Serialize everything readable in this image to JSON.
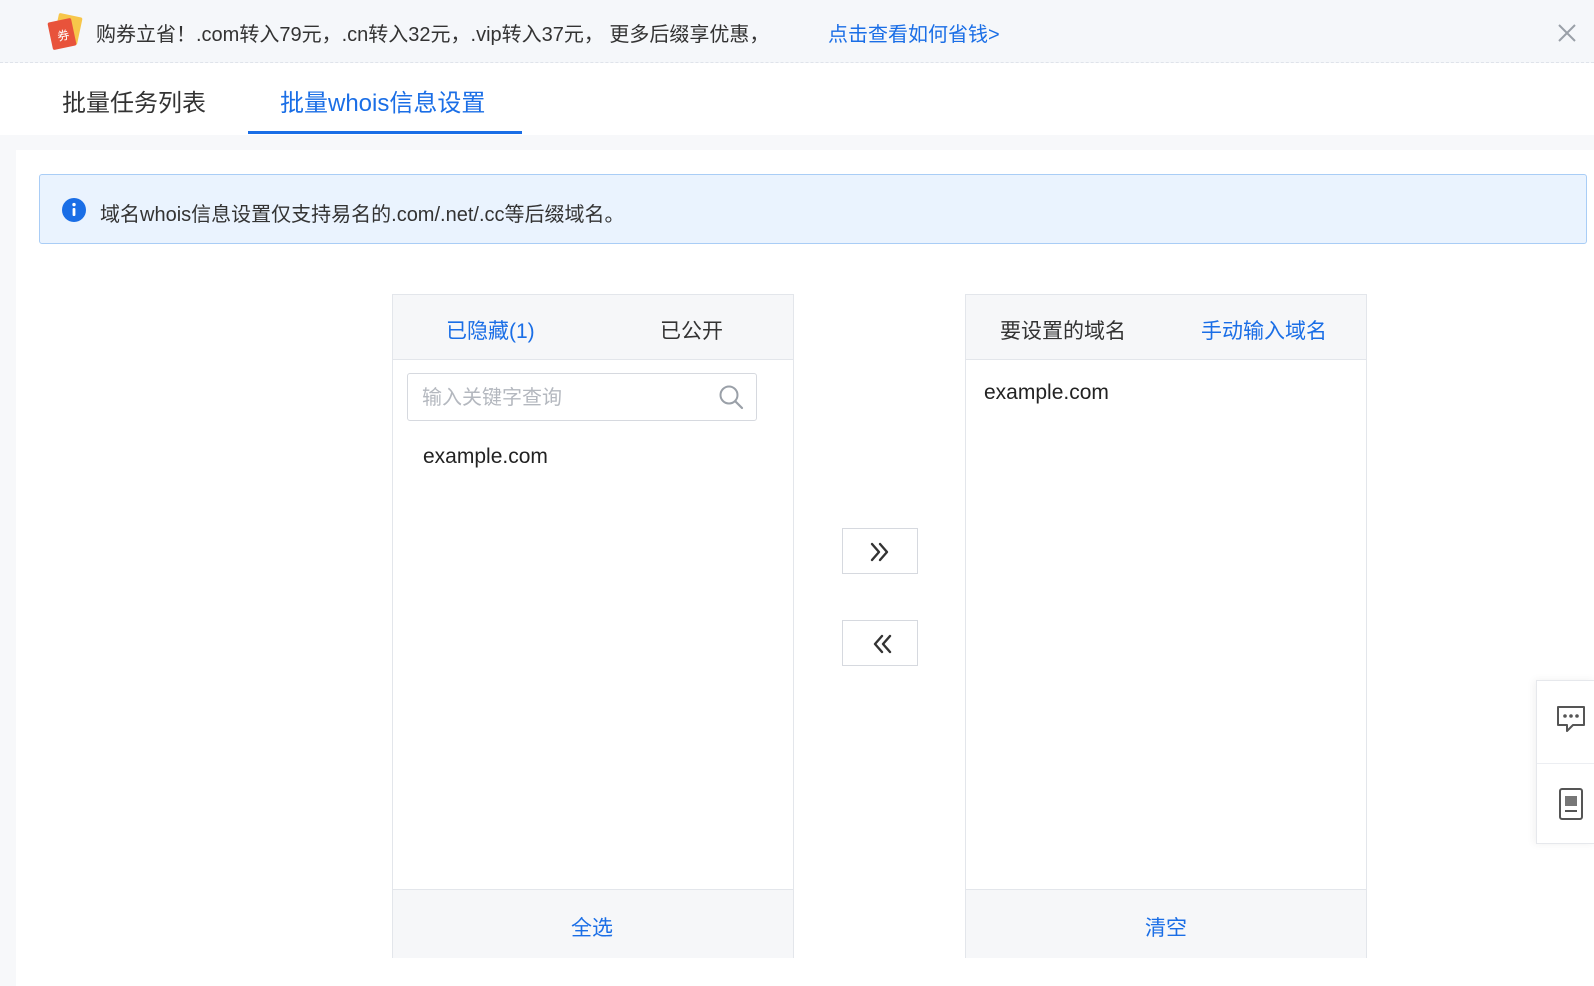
{
  "banner": {
    "text": "购券立省！.com转入79元，.cn转入32元，.vip转入37元， 更多后缀享优惠，",
    "link": "点击查看如何省钱>",
    "coupon_icon": "coupon-icon",
    "close_icon": "close-icon"
  },
  "tabs": [
    {
      "label": "批量任务列表",
      "active": false
    },
    {
      "label": "批量whois信息设置",
      "active": true
    }
  ],
  "notice": {
    "icon": "info-icon",
    "text": "域名whois信息设置仅支持易名的.com/.net/.cc等后缀域名。"
  },
  "left_panel": {
    "tabs": [
      "已隐藏(1)",
      "已公开"
    ],
    "search_placeholder": "输入关键字查询",
    "items": [
      "example.com"
    ],
    "footer_button": "全选"
  },
  "right_panel": {
    "tabs": [
      "要设置的域名",
      "手动输入域名"
    ],
    "items": [
      "example.com"
    ],
    "footer_button": "清空"
  },
  "transfer": {
    "right_icon": "double-chevron-right-icon",
    "left_icon": "double-chevron-left-icon"
  },
  "float_tools": [
    "chat-icon",
    "document-icon"
  ],
  "colors": {
    "accent": "#1a6ee6",
    "notice_bg": "#eaf3fe",
    "notice_border": "#a9cdf6"
  }
}
